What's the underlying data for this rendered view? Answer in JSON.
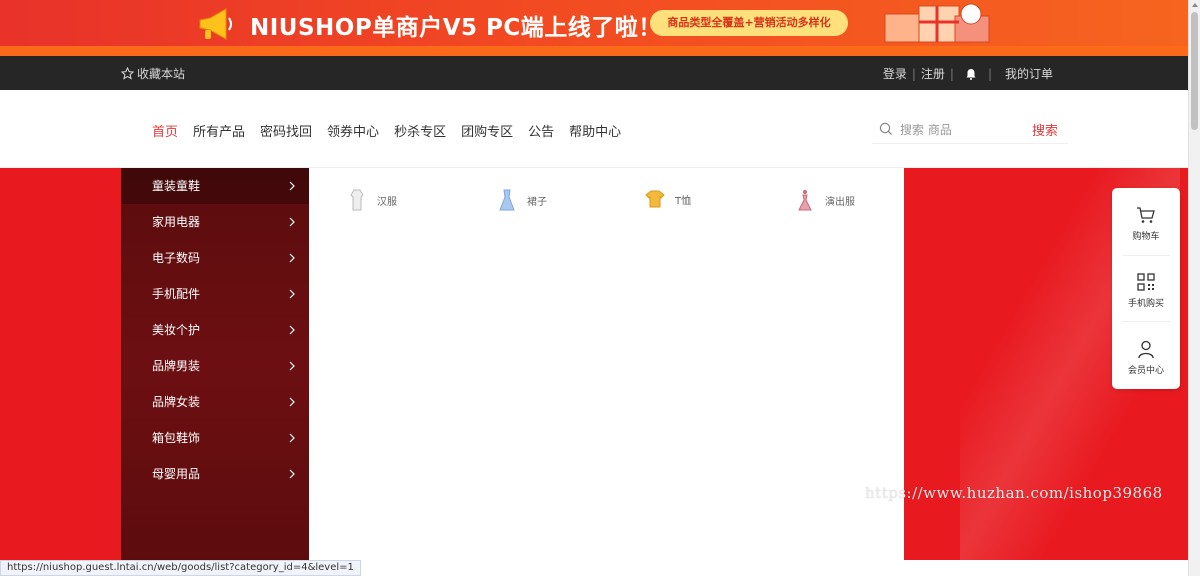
{
  "banner": {
    "headline": "NIUSHOP单商户V5  PC端上线了啦！",
    "pill": "商品类型全覆盖+营销活动多样化",
    "colors": {
      "bg": "#e8322a",
      "pill_bg": "#ffe07a"
    }
  },
  "topbar": {
    "favorite": "收藏本站",
    "login": "登录",
    "divider": "|",
    "register": "注册",
    "my_orders": "我的订单"
  },
  "nav": {
    "items": [
      "首页",
      "所有产品",
      "密码找回",
      "领券中心",
      "秒杀专区",
      "团购专区",
      "公告",
      "帮助中心"
    ],
    "active_index": 0
  },
  "search": {
    "placeholder": "搜索 商品",
    "button": "搜索"
  },
  "categories": {
    "items": [
      "童装童鞋",
      "家用电器",
      "电子数码",
      "手机配件",
      "美妆个护",
      "品牌男装",
      "品牌女装",
      "箱包鞋饰",
      "母婴用品"
    ],
    "active_index": 0
  },
  "subcategories": [
    {
      "label": "汉服",
      "icon": "hanfu-icon"
    },
    {
      "label": "裙子",
      "icon": "dress-icon"
    },
    {
      "label": "T恤",
      "icon": "tshirt-icon"
    },
    {
      "label": "演出服",
      "icon": "costume-icon"
    }
  ],
  "float_toolbar": {
    "cart": "购物车",
    "mobile_buy": "手机购买",
    "member": "会员中心"
  },
  "watermark": "https://www.huzhan.com/ishop39868",
  "status_url": "https://niushop.guest.lntai.cn/web/goods/list?category_id=4&level=1",
  "colors": {
    "accent": "#e4393c",
    "hero_bg": "#e8191f",
    "topbar_bg": "#262626"
  }
}
